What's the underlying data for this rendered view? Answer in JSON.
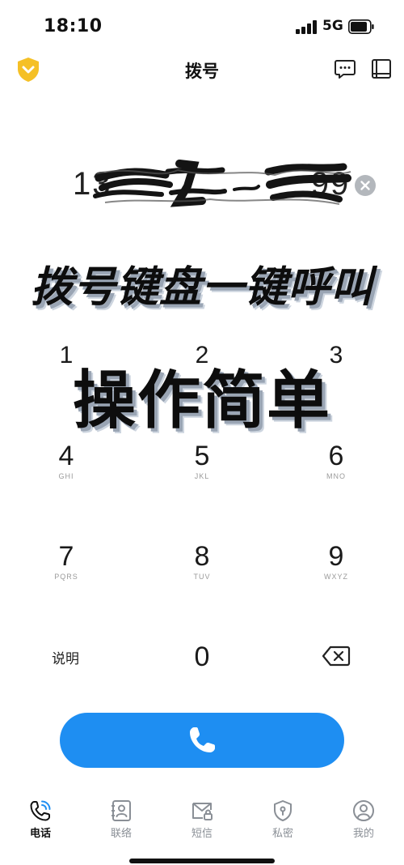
{
  "status_bar": {
    "time": "18:10",
    "network": "5G",
    "icons": [
      "signal-icon",
      "battery-icon"
    ]
  },
  "header": {
    "title": "拨号",
    "icons": [
      "shield-badge-icon",
      "message-icon",
      "book-icon"
    ]
  },
  "dialer": {
    "number_prefix": "13",
    "number_suffix": "99",
    "clear_icon": "clear-icon"
  },
  "overlay": {
    "line1": "拨号键盘一键呼叫",
    "line2": "操作简单"
  },
  "keypad": {
    "keys": [
      {
        "digit": "1",
        "letters": ""
      },
      {
        "digit": "2",
        "letters": ""
      },
      {
        "digit": "3",
        "letters": ""
      },
      {
        "digit": "4",
        "letters": "GHI"
      },
      {
        "digit": "5",
        "letters": "JKL"
      },
      {
        "digit": "6",
        "letters": "MNO"
      },
      {
        "digit": "7",
        "letters": "PQRS"
      },
      {
        "digit": "8",
        "letters": "TUV"
      },
      {
        "digit": "9",
        "letters": "WXYZ"
      },
      {
        "digit": "0",
        "letters": ""
      }
    ],
    "explain_label": "说明",
    "backspace_icon": "backspace-icon"
  },
  "call_button": {
    "icon": "phone-icon",
    "color": "#1e8ef2"
  },
  "bottom_nav": {
    "items": [
      {
        "label": "电话",
        "icon": "phone-call-icon",
        "active": true
      },
      {
        "label": "联络",
        "icon": "contacts-icon",
        "active": false
      },
      {
        "label": "短信",
        "icon": "sms-lock-icon",
        "active": false
      },
      {
        "label": "私密",
        "icon": "privacy-shield-icon",
        "active": false
      },
      {
        "label": "我的",
        "icon": "profile-icon",
        "active": false
      }
    ]
  },
  "colors": {
    "accent": "#1e8ef2",
    "badge": "#f5c026",
    "inactive": "#8a8f96"
  }
}
